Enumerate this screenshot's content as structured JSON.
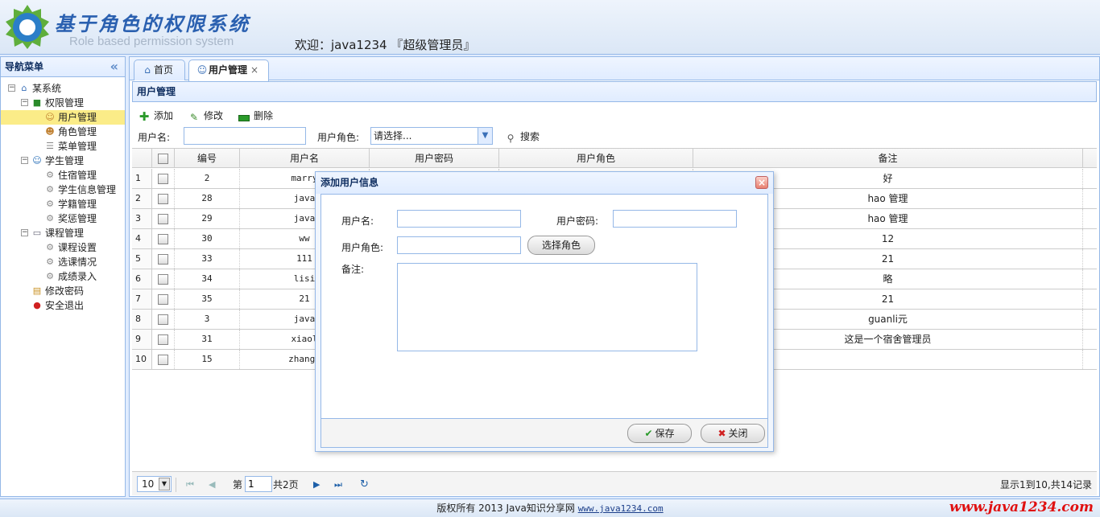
{
  "header": {
    "title_cn": "基于角色的权限系统",
    "subtitle_en": "Role based permission system",
    "welcome": "欢迎：java1234 『超级管理员』"
  },
  "nav": {
    "title": "导航菜单",
    "collapse_glyph": "«",
    "tree": [
      {
        "label": "某系统",
        "icon": "home-icon",
        "level": 0,
        "toggle": "−"
      },
      {
        "label": "权限管理",
        "icon": "book-icon",
        "level": 1,
        "toggle": "−"
      },
      {
        "label": "用户管理",
        "icon": "user-icon",
        "level": 2,
        "selected": true
      },
      {
        "label": "角色管理",
        "icon": "role-icon",
        "level": 2
      },
      {
        "label": "菜单管理",
        "icon": "menu-icon",
        "level": 2
      },
      {
        "label": "学生管理",
        "icon": "students-icon",
        "level": 1,
        "toggle": "−"
      },
      {
        "label": "住宿管理",
        "icon": "gear-icon",
        "level": 2
      },
      {
        "label": "学生信息管理",
        "icon": "gear-icon",
        "level": 2
      },
      {
        "label": "学籍管理",
        "icon": "gear-icon",
        "level": 2
      },
      {
        "label": "奖惩管理",
        "icon": "gear-icon",
        "level": 2
      },
      {
        "label": "课程管理",
        "icon": "board-icon",
        "level": 1,
        "toggle": "−"
      },
      {
        "label": "课程设置",
        "icon": "gear-icon",
        "level": 2
      },
      {
        "label": "选课情况",
        "icon": "gear-icon",
        "level": 2
      },
      {
        "label": "成绩录入",
        "icon": "gear-icon",
        "level": 2
      },
      {
        "label": "修改密码",
        "icon": "lock-icon",
        "level": 1
      },
      {
        "label": "安全退出",
        "icon": "exit-icon",
        "level": 1
      }
    ]
  },
  "tabs": [
    {
      "label": "首页",
      "icon": "home-icon",
      "active": false
    },
    {
      "label": "用户管理",
      "icon": "user-icon",
      "active": true,
      "close": "×"
    }
  ],
  "panel": {
    "title": "用户管理",
    "toolbar": {
      "add": "添加",
      "edit": "修改",
      "delete": "删除"
    },
    "search": {
      "username_label": "用户名:",
      "username_value": "",
      "role_label": "用户角色:",
      "role_value": "请选择...",
      "search_button": "搜索"
    }
  },
  "grid": {
    "columns": [
      "编号",
      "用户名",
      "用户密码",
      "用户角色",
      "备注"
    ],
    "rows": [
      {
        "n": "1",
        "id": "2",
        "user": "marry",
        "note": "好"
      },
      {
        "n": "2",
        "id": "28",
        "user": "java",
        "note": "hao 管理"
      },
      {
        "n": "3",
        "id": "29",
        "user": "java",
        "note": "hao 管理"
      },
      {
        "n": "4",
        "id": "30",
        "user": "ww",
        "note": "12"
      },
      {
        "n": "5",
        "id": "33",
        "user": "111",
        "note": "21"
      },
      {
        "n": "6",
        "id": "34",
        "user": "lisi",
        "note": "略"
      },
      {
        "n": "7",
        "id": "35",
        "user": "21",
        "note": "21"
      },
      {
        "n": "8",
        "id": "3",
        "user": "java",
        "note": "guanli元"
      },
      {
        "n": "9",
        "id": "31",
        "user": "xiaol",
        "note": "这是一个宿舍管理员"
      },
      {
        "n": "10",
        "id": "15",
        "user": "zhangs",
        "note": ""
      }
    ]
  },
  "pager": {
    "page_size": "10",
    "page_label": "第",
    "page_value": "1",
    "total_pages": "共2页",
    "summary": "显示1到10,共14记录"
  },
  "dialog": {
    "title": "添加用户信息",
    "username_label": "用户名:",
    "password_label": "用户密码:",
    "role_label": "用户角色:",
    "select_role_button": "选择角色",
    "remark_label": "备注:",
    "save_button": "保存",
    "close_button": "关闭"
  },
  "footer": {
    "copyright": "版权所有 2013 Java知识分享网",
    "link": "www.java1234.com",
    "watermark": "www.java1234.com"
  },
  "colors": {
    "accent_blue": "#95b8e7",
    "header_bg": "#dbe7f6",
    "selected_row": "#fbec88",
    "watermark_red": "#e01010"
  }
}
